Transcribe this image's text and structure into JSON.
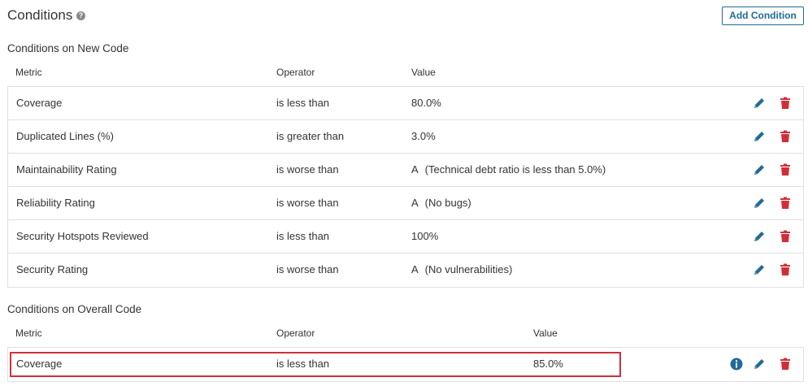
{
  "header": {
    "title": "Conditions",
    "help_icon": "question-circle-icon",
    "add_button_label": "Add Condition"
  },
  "colors": {
    "accent": "#236a97",
    "delete": "#d02f3a",
    "highlight": "#d0303a",
    "border": "#e0e0e0"
  },
  "new_code": {
    "title": "Conditions on New Code",
    "columns": [
      "Metric",
      "Operator",
      "Value"
    ],
    "rows": [
      {
        "metric": "Coverage",
        "operator": "is less than",
        "grade": "",
        "value": "80.0%"
      },
      {
        "metric": "Duplicated Lines (%)",
        "operator": "is greater than",
        "grade": "",
        "value": "3.0%"
      },
      {
        "metric": "Maintainability Rating",
        "operator": "is worse than",
        "grade": "A",
        "value": "(Technical debt ratio is less than 5.0%)"
      },
      {
        "metric": "Reliability Rating",
        "operator": "is worse than",
        "grade": "A",
        "value": "(No bugs)"
      },
      {
        "metric": "Security Hotspots Reviewed",
        "operator": "is less than",
        "grade": "",
        "value": "100%"
      },
      {
        "metric": "Security Rating",
        "operator": "is worse than",
        "grade": "A",
        "value": "(No vulnerabilities)"
      }
    ]
  },
  "overall_code": {
    "title": "Conditions on Overall Code",
    "columns": [
      "Metric",
      "Operator",
      "Value"
    ],
    "rows": [
      {
        "metric": "Coverage",
        "operator": "is less than",
        "value": "85.0%"
      }
    ]
  }
}
